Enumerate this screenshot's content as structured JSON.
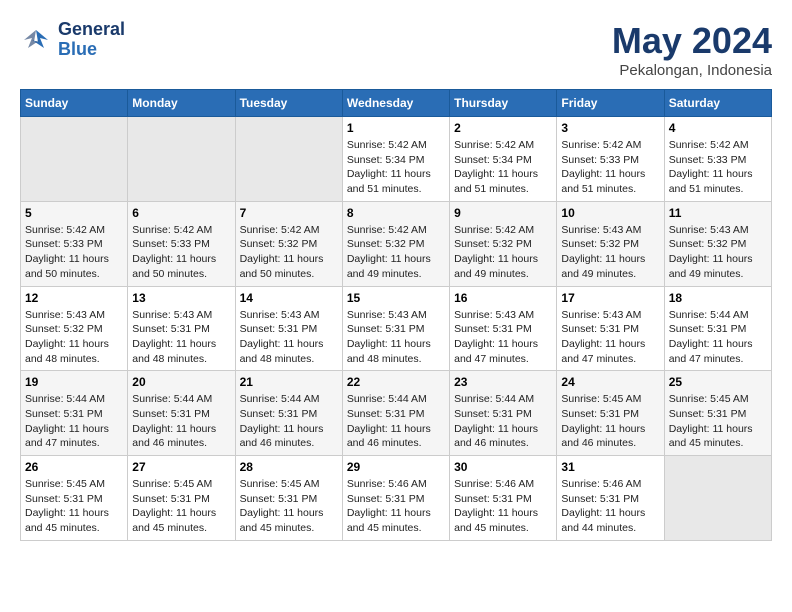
{
  "logo": {
    "line1": "General",
    "line2": "Blue"
  },
  "title": "May 2024",
  "location": "Pekalongan, Indonesia",
  "days_header": [
    "Sunday",
    "Monday",
    "Tuesday",
    "Wednesday",
    "Thursday",
    "Friday",
    "Saturday"
  ],
  "weeks": [
    [
      {
        "num": "",
        "info": ""
      },
      {
        "num": "",
        "info": ""
      },
      {
        "num": "",
        "info": ""
      },
      {
        "num": "1",
        "info": "Sunrise: 5:42 AM\nSunset: 5:34 PM\nDaylight: 11 hours\nand 51 minutes."
      },
      {
        "num": "2",
        "info": "Sunrise: 5:42 AM\nSunset: 5:34 PM\nDaylight: 11 hours\nand 51 minutes."
      },
      {
        "num": "3",
        "info": "Sunrise: 5:42 AM\nSunset: 5:33 PM\nDaylight: 11 hours\nand 51 minutes."
      },
      {
        "num": "4",
        "info": "Sunrise: 5:42 AM\nSunset: 5:33 PM\nDaylight: 11 hours\nand 51 minutes."
      }
    ],
    [
      {
        "num": "5",
        "info": "Sunrise: 5:42 AM\nSunset: 5:33 PM\nDaylight: 11 hours\nand 50 minutes."
      },
      {
        "num": "6",
        "info": "Sunrise: 5:42 AM\nSunset: 5:33 PM\nDaylight: 11 hours\nand 50 minutes."
      },
      {
        "num": "7",
        "info": "Sunrise: 5:42 AM\nSunset: 5:32 PM\nDaylight: 11 hours\nand 50 minutes."
      },
      {
        "num": "8",
        "info": "Sunrise: 5:42 AM\nSunset: 5:32 PM\nDaylight: 11 hours\nand 49 minutes."
      },
      {
        "num": "9",
        "info": "Sunrise: 5:42 AM\nSunset: 5:32 PM\nDaylight: 11 hours\nand 49 minutes."
      },
      {
        "num": "10",
        "info": "Sunrise: 5:43 AM\nSunset: 5:32 PM\nDaylight: 11 hours\nand 49 minutes."
      },
      {
        "num": "11",
        "info": "Sunrise: 5:43 AM\nSunset: 5:32 PM\nDaylight: 11 hours\nand 49 minutes."
      }
    ],
    [
      {
        "num": "12",
        "info": "Sunrise: 5:43 AM\nSunset: 5:32 PM\nDaylight: 11 hours\nand 48 minutes."
      },
      {
        "num": "13",
        "info": "Sunrise: 5:43 AM\nSunset: 5:31 PM\nDaylight: 11 hours\nand 48 minutes."
      },
      {
        "num": "14",
        "info": "Sunrise: 5:43 AM\nSunset: 5:31 PM\nDaylight: 11 hours\nand 48 minutes."
      },
      {
        "num": "15",
        "info": "Sunrise: 5:43 AM\nSunset: 5:31 PM\nDaylight: 11 hours\nand 48 minutes."
      },
      {
        "num": "16",
        "info": "Sunrise: 5:43 AM\nSunset: 5:31 PM\nDaylight: 11 hours\nand 47 minutes."
      },
      {
        "num": "17",
        "info": "Sunrise: 5:43 AM\nSunset: 5:31 PM\nDaylight: 11 hours\nand 47 minutes."
      },
      {
        "num": "18",
        "info": "Sunrise: 5:44 AM\nSunset: 5:31 PM\nDaylight: 11 hours\nand 47 minutes."
      }
    ],
    [
      {
        "num": "19",
        "info": "Sunrise: 5:44 AM\nSunset: 5:31 PM\nDaylight: 11 hours\nand 47 minutes."
      },
      {
        "num": "20",
        "info": "Sunrise: 5:44 AM\nSunset: 5:31 PM\nDaylight: 11 hours\nand 46 minutes."
      },
      {
        "num": "21",
        "info": "Sunrise: 5:44 AM\nSunset: 5:31 PM\nDaylight: 11 hours\nand 46 minutes."
      },
      {
        "num": "22",
        "info": "Sunrise: 5:44 AM\nSunset: 5:31 PM\nDaylight: 11 hours\nand 46 minutes."
      },
      {
        "num": "23",
        "info": "Sunrise: 5:44 AM\nSunset: 5:31 PM\nDaylight: 11 hours\nand 46 minutes."
      },
      {
        "num": "24",
        "info": "Sunrise: 5:45 AM\nSunset: 5:31 PM\nDaylight: 11 hours\nand 46 minutes."
      },
      {
        "num": "25",
        "info": "Sunrise: 5:45 AM\nSunset: 5:31 PM\nDaylight: 11 hours\nand 45 minutes."
      }
    ],
    [
      {
        "num": "26",
        "info": "Sunrise: 5:45 AM\nSunset: 5:31 PM\nDaylight: 11 hours\nand 45 minutes."
      },
      {
        "num": "27",
        "info": "Sunrise: 5:45 AM\nSunset: 5:31 PM\nDaylight: 11 hours\nand 45 minutes."
      },
      {
        "num": "28",
        "info": "Sunrise: 5:45 AM\nSunset: 5:31 PM\nDaylight: 11 hours\nand 45 minutes."
      },
      {
        "num": "29",
        "info": "Sunrise: 5:46 AM\nSunset: 5:31 PM\nDaylight: 11 hours\nand 45 minutes."
      },
      {
        "num": "30",
        "info": "Sunrise: 5:46 AM\nSunset: 5:31 PM\nDaylight: 11 hours\nand 45 minutes."
      },
      {
        "num": "31",
        "info": "Sunrise: 5:46 AM\nSunset: 5:31 PM\nDaylight: 11 hours\nand 44 minutes."
      },
      {
        "num": "",
        "info": ""
      }
    ]
  ]
}
